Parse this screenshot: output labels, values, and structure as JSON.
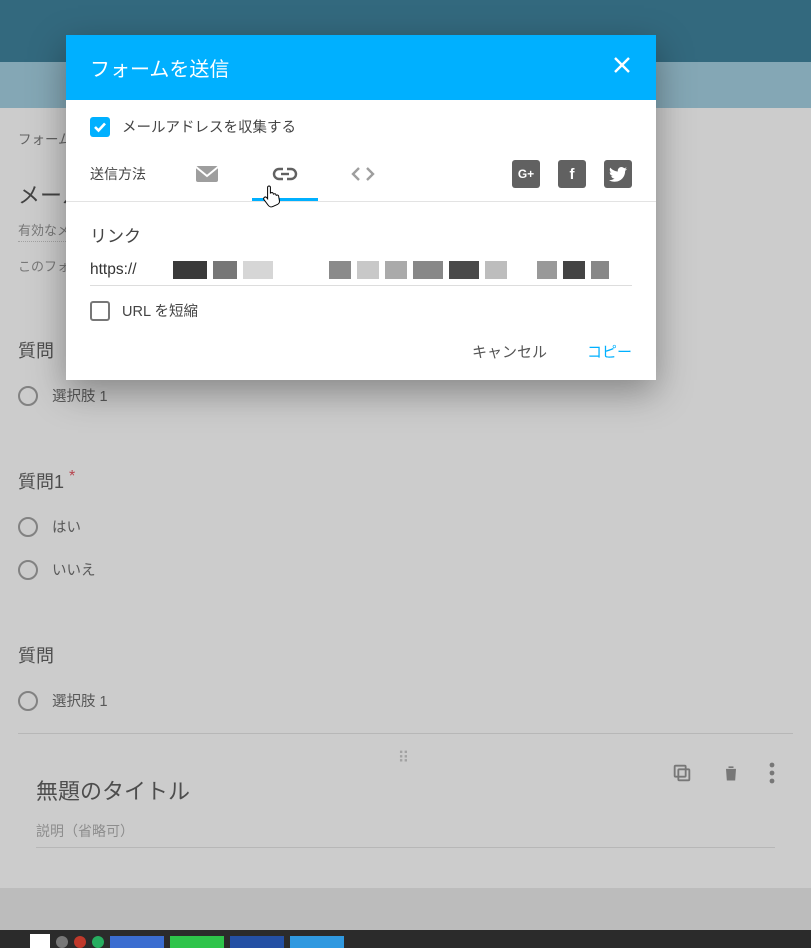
{
  "background": {
    "form_label": "フォーム",
    "mail_heading": "メール",
    "valid_hint": "有効なメ",
    "this_form_hint": "このフォ",
    "q_untitled": "質問",
    "option1": "選択肢 1",
    "q1": "質問1",
    "yes": "はい",
    "no": "いいえ",
    "card_title": "無題のタイトル",
    "card_desc": "説明（省略可）",
    "drag": "⠿"
  },
  "modal": {
    "title": "フォームを送信",
    "collect_email": "メールアドレスを収集する",
    "method_label": "送信方法",
    "link_section": "リンク",
    "url_prefix": "https://",
    "shorten_url": "URL を短縮",
    "cancel": "キャンセル",
    "copy": "コピー",
    "social": {
      "google": "G+",
      "facebook": "f"
    }
  },
  "colors": {
    "accent": "#00b0ff"
  }
}
